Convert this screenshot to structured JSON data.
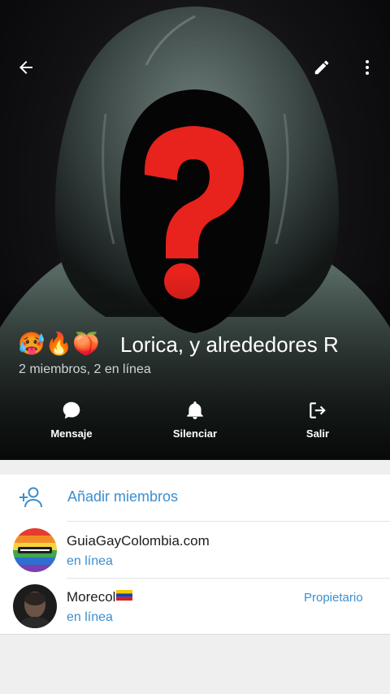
{
  "header": {
    "emojis": [
      "🥵",
      "🔥",
      "🍑"
    ],
    "title": "Lorica, y alrededores R",
    "subtitle": "2 miembros, 2 en línea",
    "icons": {
      "back": "arrow-left-icon",
      "edit": "pencil-icon",
      "more": "more-vertical-icon"
    },
    "actions": [
      {
        "label": "Mensaje",
        "icon": "message-bubble-icon"
      },
      {
        "label": "Silenciar",
        "icon": "bell-icon"
      },
      {
        "label": "Salir",
        "icon": "logout-icon"
      }
    ]
  },
  "members_section": {
    "add_label": "Añadir miembros",
    "add_icon": "add-user-icon",
    "members": [
      {
        "name": "GuiaGayColombia.com",
        "status": "en línea",
        "role": ""
      },
      {
        "name": "Morecol",
        "status": "en línea",
        "role": "Propietario"
      }
    ]
  },
  "colors": {
    "accent": "#3a8fd0",
    "text": "#1d1d1f",
    "background": "#efeff0",
    "question_mark": "#e8221c"
  }
}
